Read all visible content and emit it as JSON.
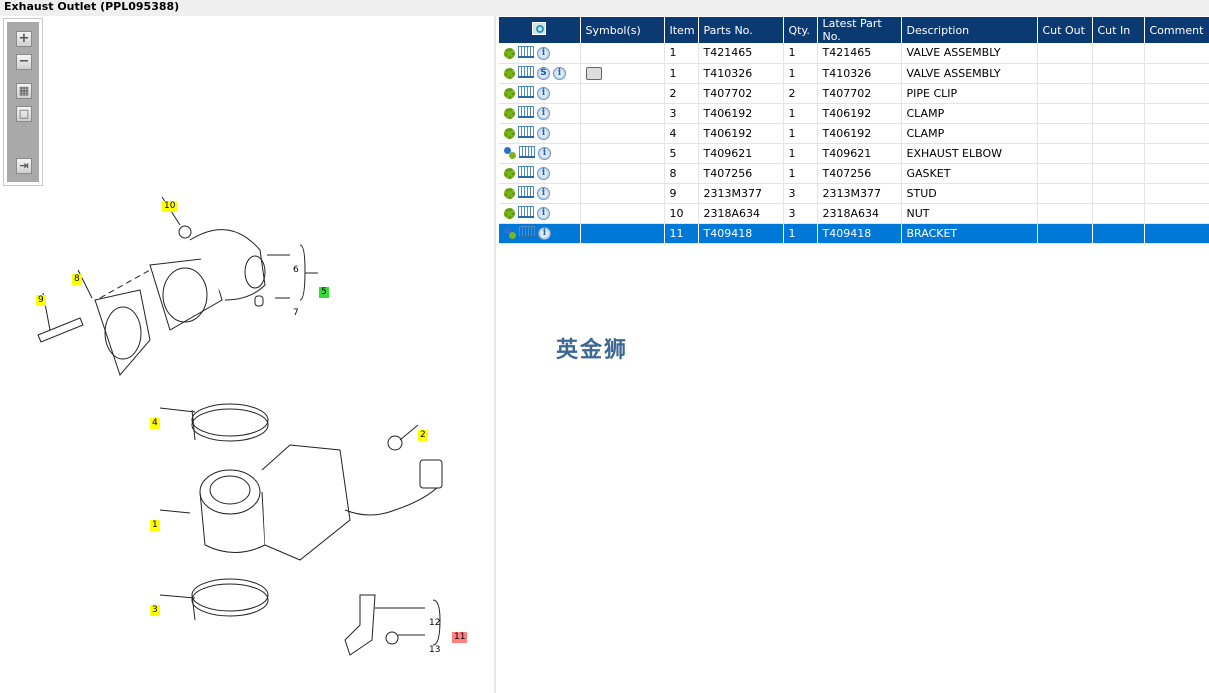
{
  "title": "Exhaust Outlet (PPL095388)",
  "toolbar": {
    "zoom_in": "+",
    "zoom_out": "−",
    "fit": "▦",
    "actual": "□",
    "export": "⇥"
  },
  "callouts": [
    {
      "label": "10",
      "color": "yellow"
    },
    {
      "label": "8",
      "color": "yellow"
    },
    {
      "label": "9",
      "color": "yellow"
    },
    {
      "label": "6",
      "color": "none"
    },
    {
      "label": "7",
      "color": "none"
    },
    {
      "label": "5",
      "color": "green"
    },
    {
      "label": "4",
      "color": "yellow"
    },
    {
      "label": "2",
      "color": "yellow"
    },
    {
      "label": "1",
      "color": "yellow"
    },
    {
      "label": "3",
      "color": "yellow"
    },
    {
      "label": "12",
      "color": "none"
    },
    {
      "label": "13",
      "color": "none"
    },
    {
      "label": "11",
      "color": "red"
    }
  ],
  "columns": [
    "",
    "Symbol(s)",
    "Item",
    "Parts No.",
    "Qty.",
    "Latest Part No.",
    "Description",
    "Cut Out",
    "Cut In",
    "Comment"
  ],
  "rows": [
    {
      "icon": "gear-icon",
      "s": false,
      "symbol": false,
      "item": "1",
      "part": "T421465",
      "qty": "1",
      "latest": "T421465",
      "desc": "VALVE ASSEMBLY"
    },
    {
      "icon": "gear-icon",
      "s": true,
      "symbol": true,
      "item": "1",
      "part": "T410326",
      "qty": "1",
      "latest": "T410326",
      "desc": "VALVE ASSEMBLY"
    },
    {
      "icon": "gear-icon",
      "s": false,
      "symbol": false,
      "item": "2",
      "part": "T407702",
      "qty": "2",
      "latest": "T407702",
      "desc": "PIPE CLIP"
    },
    {
      "icon": "gear-icon",
      "s": false,
      "symbol": false,
      "item": "3",
      "part": "T406192",
      "qty": "1",
      "latest": "T406192",
      "desc": "CLAMP"
    },
    {
      "icon": "gear-icon",
      "s": false,
      "symbol": false,
      "item": "4",
      "part": "T406192",
      "qty": "1",
      "latest": "T406192",
      "desc": "CLAMP"
    },
    {
      "icon": "gears-icon",
      "s": false,
      "symbol": false,
      "item": "5",
      "part": "T409621",
      "qty": "1",
      "latest": "T409621",
      "desc": "EXHAUST ELBOW"
    },
    {
      "icon": "gear-icon",
      "s": false,
      "symbol": false,
      "item": "8",
      "part": "T407256",
      "qty": "1",
      "latest": "T407256",
      "desc": "GASKET"
    },
    {
      "icon": "gear-icon",
      "s": false,
      "symbol": false,
      "item": "9",
      "part": "2313M377",
      "qty": "3",
      "latest": "2313M377",
      "desc": "STUD"
    },
    {
      "icon": "gear-icon",
      "s": false,
      "symbol": false,
      "item": "10",
      "part": "2318A634",
      "qty": "3",
      "latest": "2318A634",
      "desc": "NUT"
    },
    {
      "icon": "gears-icon",
      "s": false,
      "symbol": false,
      "item": "11",
      "part": "T409418",
      "qty": "1",
      "latest": "T409418",
      "desc": "BRACKET",
      "selected": true
    }
  ],
  "s_label": "S",
  "info_label": "i",
  "watermark": "英金狮",
  "colors": {
    "header": "#0b3a73",
    "selected": "#0078d7"
  }
}
